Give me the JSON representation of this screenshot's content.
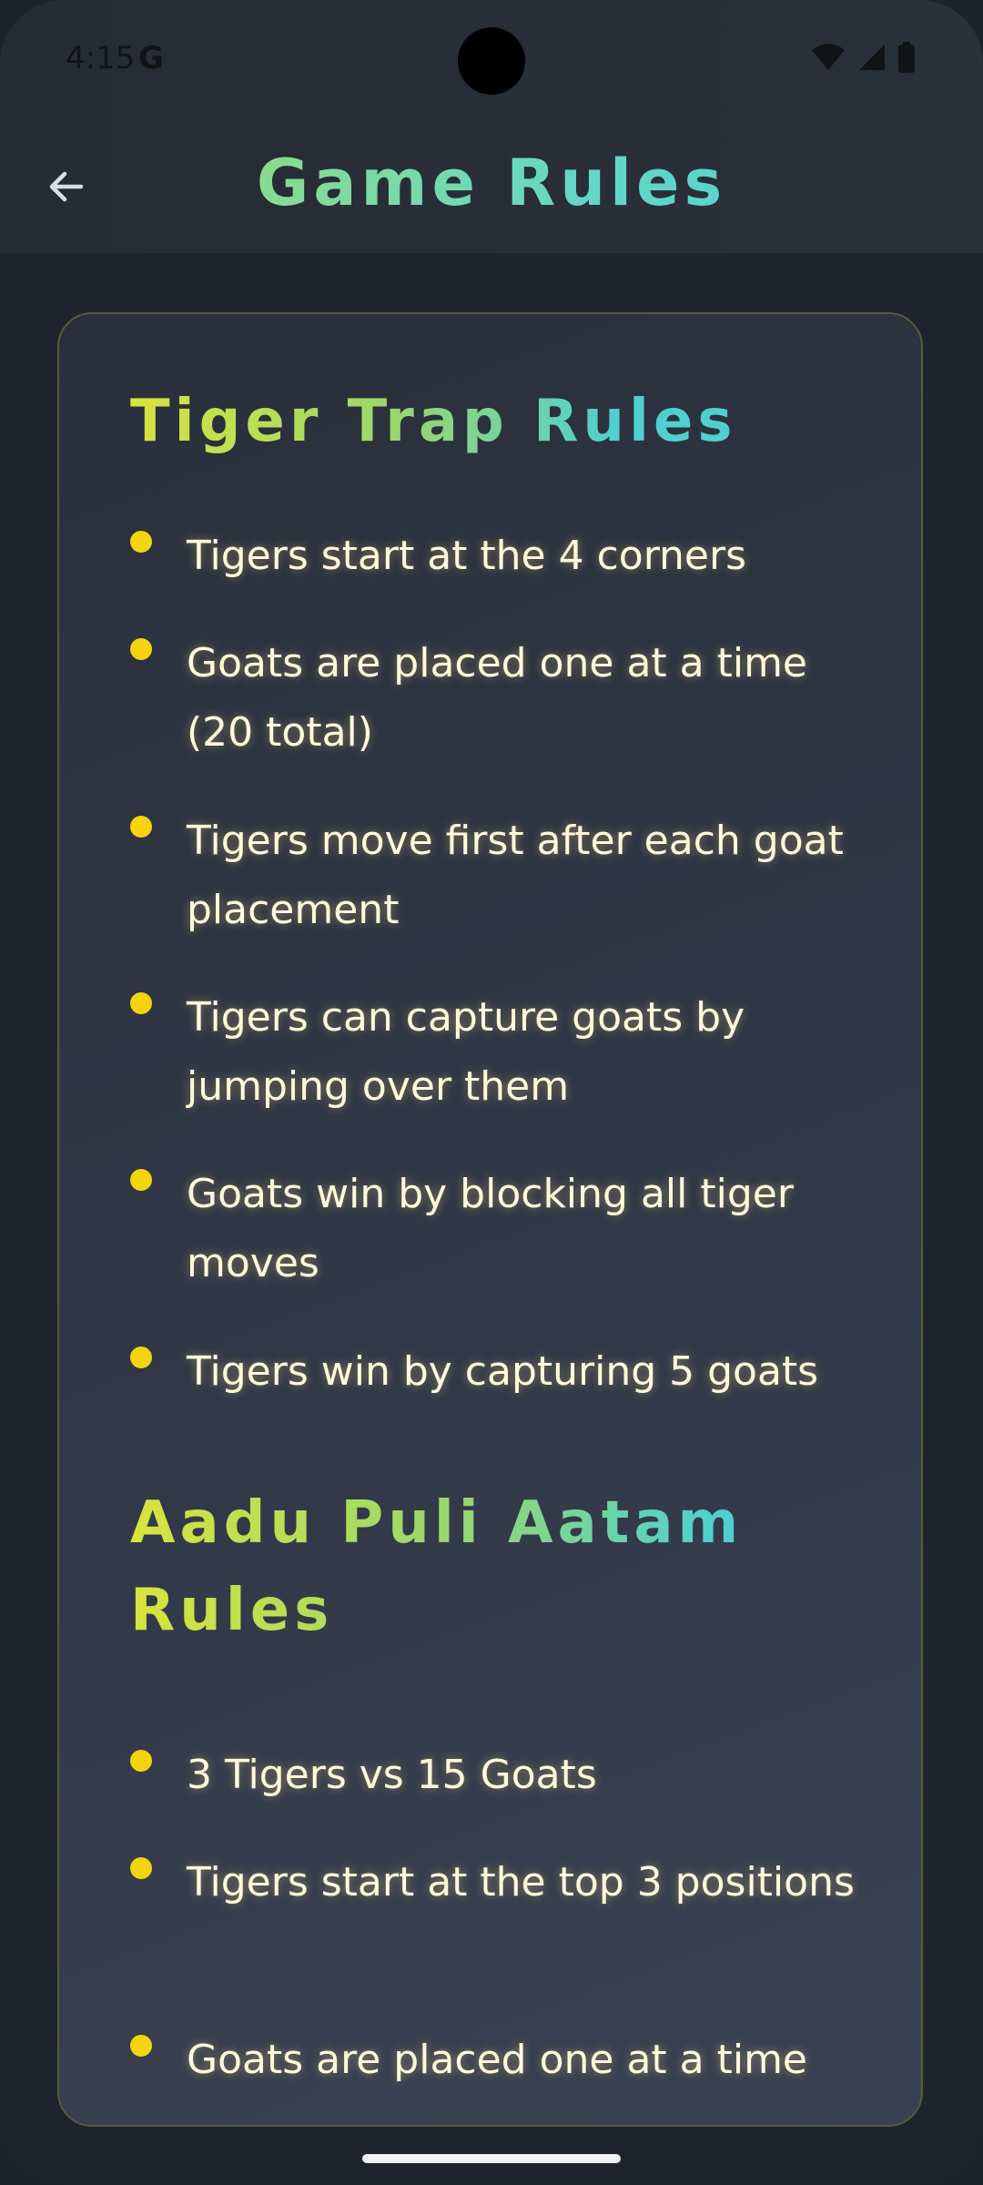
{
  "status_bar": {
    "time": "4:15",
    "g_label": "G",
    "icons": [
      "wifi-icon",
      "signal-icon",
      "battery-icon"
    ]
  },
  "header": {
    "title": "Game Rules",
    "back_icon": "arrow-left-icon"
  },
  "sections": [
    {
      "title": "Tiger Trap Rules",
      "rules": [
        "Tigers start at the 4 corners",
        "Goats are placed one at a time (20 total)",
        "Tigers move first after each goat placement",
        "Tigers can capture goats by jumping over them",
        "Goats win by blocking all tiger moves",
        "Tigers win by capturing 5 goats"
      ]
    },
    {
      "title": "Aadu Puli Aatam Rules",
      "rules": [
        "3 Tigers vs 15 Goats",
        "Tigers start at the top 3 positions",
        "Goats are placed one at a time"
      ]
    }
  ],
  "colors": {
    "background": "#1f232c",
    "bullet": "#f4d40c",
    "rule_text": "#fff8dc",
    "title_gradient_start": "#d8e33d",
    "title_gradient_end": "#4fd0cf"
  }
}
